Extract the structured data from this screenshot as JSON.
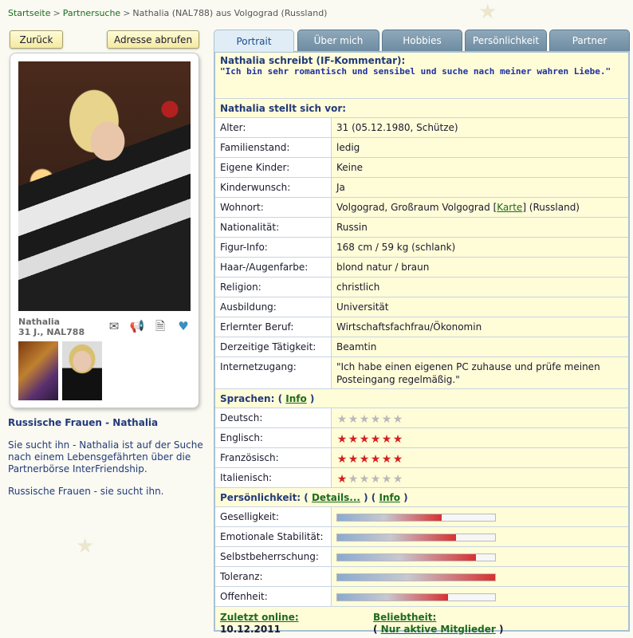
{
  "breadcrumb": {
    "home": "Startseite",
    "sep1": ">",
    "search": "Partnersuche",
    "sep2": ">",
    "current": "Nathalia (NAL788) aus Volgograd (Russland)"
  },
  "buttons": {
    "back": "Zurück",
    "address": "Adresse abrufen"
  },
  "card": {
    "name": "Nathalia",
    "info": "31 J., NAL788",
    "icons": [
      "mail-icon",
      "megaphone-icon",
      "pdf-icon",
      "favorite-add-icon"
    ]
  },
  "left": {
    "title": "Russische Frauen - Nathalia",
    "para1": "Sie sucht ihn - Nathalia ist auf der Suche nach einem Lebensgefährten über die Partnerbörse InterFriendship.",
    "para2": "Russische Frauen - sie sucht ihn."
  },
  "tabs": [
    "Portrait",
    "Über mich",
    "Hobbies",
    "Persönlichkeit",
    "Partner"
  ],
  "comment": {
    "title": "Nathalia schreibt (IF-Kommentar):",
    "text": "\"Ich bin sehr romantisch und sensibel und suche nach meiner wahren Liebe.\""
  },
  "intro": {
    "title": "Nathalia stellt sich vor:",
    "rows": [
      {
        "label": "Alter:",
        "value": "31 (05.12.1980, Schütze)"
      },
      {
        "label": "Familienstand:",
        "value": "ledig"
      },
      {
        "label": "Eigene Kinder:",
        "value": "Keine"
      },
      {
        "label": "Kinderwunsch:",
        "value": "Ja"
      },
      {
        "label": "Wohnort:",
        "value_pre": "Volgograd, Großraum Volgograd [",
        "value_link": "Karte",
        "value_post": "] (Russland)"
      },
      {
        "label": "Nationalität:",
        "value": "Russin"
      },
      {
        "label": "Figur-Info:",
        "value": "168 cm / 59 kg (schlank)"
      },
      {
        "label": "Haar-/Augenfarbe:",
        "value": "blond natur / braun"
      },
      {
        "label": "Religion:",
        "value": "christlich"
      },
      {
        "label": "Ausbildung:",
        "value": "Universität"
      },
      {
        "label": "Erlernter Beruf:",
        "value": "Wirtschaftsfachfrau/Ökonomin"
      },
      {
        "label": "Derzeitige Tätigkeit:",
        "value": "Beamtin"
      },
      {
        "label": "Internetzugang:",
        "value": "\"Ich habe einen eigenen PC zuhause und prüfe meinen Posteingang regelmäßig.\""
      }
    ]
  },
  "languages": {
    "title": "Sprachen:",
    "paren_open": "(",
    "info": "Info",
    "paren_close": ")",
    "max_stars": 6,
    "rows": [
      {
        "label": "Deutsch:",
        "stars": 0
      },
      {
        "label": "Englisch:",
        "stars": 6
      },
      {
        "label": "Französisch:",
        "stars": 6
      },
      {
        "label": "Italienisch:",
        "stars": 1
      }
    ]
  },
  "personality": {
    "title": "Persönlichkeit:",
    "paren_open": "(",
    "details": "Details...",
    "mid": ") (",
    "info": "Info",
    "paren_close": ")",
    "rows": [
      {
        "label": "Geselligkeit:",
        "level": 0.66
      },
      {
        "label": "Emotionale Stabilität:",
        "level": 0.75
      },
      {
        "label": "Selbstbeherrschung:",
        "level": 0.88
      },
      {
        "label": "Toleranz:",
        "level": 1.0
      },
      {
        "label": "Offenheit:",
        "level": 0.7
      }
    ]
  },
  "footer": {
    "last_online_label": "Zuletzt online:",
    "last_online_value": "10.12.2011",
    "popularity_label": "Beliebtheit:",
    "popularity_pre": "( ",
    "popularity_link": "Nur aktive Mitglieder",
    "popularity_post": " )"
  }
}
